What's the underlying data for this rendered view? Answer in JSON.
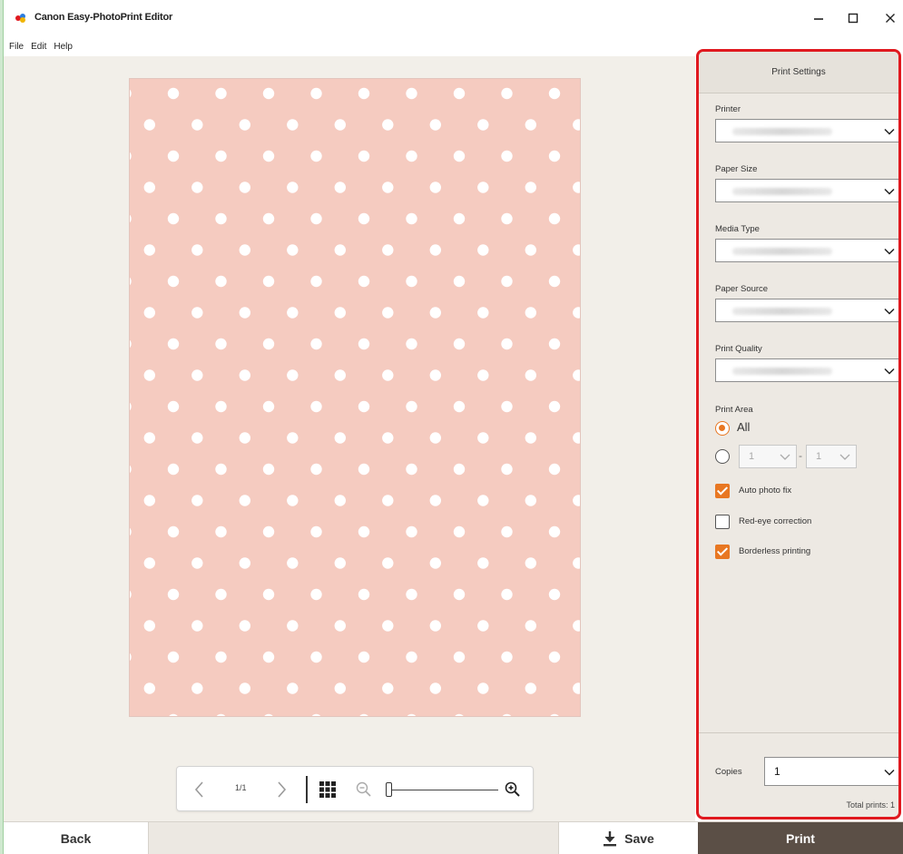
{
  "window": {
    "title": "Canon Easy-PhotoPrint Editor",
    "minimize_icon": "minimize-icon",
    "maximize_icon": "maximize-icon",
    "close_icon": "close-icon"
  },
  "menu": [
    "File",
    "Edit",
    "Help"
  ],
  "preview": {
    "page_color": "#f5cbc0",
    "dot_color": "#ffffff"
  },
  "navigation": {
    "page_indicator": "1/1",
    "prev_icon": "chevron-left-icon",
    "next_icon": "chevron-right-icon",
    "grid_icon": "grid-view-icon",
    "zoom_out_icon": "zoom-out-icon",
    "zoom_in_icon": "zoom-in-icon",
    "zoom_level": 0
  },
  "print_settings": {
    "title": "Print Settings",
    "printer": {
      "label": "Printer"
    },
    "paper_size": {
      "label": "Paper Size"
    },
    "media_type": {
      "label": "Media Type"
    },
    "paper_source": {
      "label": "Paper Source"
    },
    "print_quality": {
      "label": "Print Quality"
    },
    "print_area": {
      "label": "Print Area",
      "option_all": "All",
      "range_from": "1",
      "range_to": "1",
      "range_separator": "-"
    },
    "auto_photo_fix": {
      "label": "Auto photo fix",
      "checked": true
    },
    "red_eye_correction": {
      "label": "Red-eye correction",
      "checked": false
    },
    "borderless_printing": {
      "label": "Borderless printing",
      "checked": true
    },
    "copies": {
      "label": "Copies",
      "value": "1"
    },
    "total_prints": "Total prints: 1"
  },
  "footer": {
    "back_label": "Back",
    "save_label": "Save",
    "print_label": "Print"
  },
  "colors": {
    "accent": "#e87722",
    "highlight_border": "#e0191f",
    "print_button": "#5b4f46"
  }
}
